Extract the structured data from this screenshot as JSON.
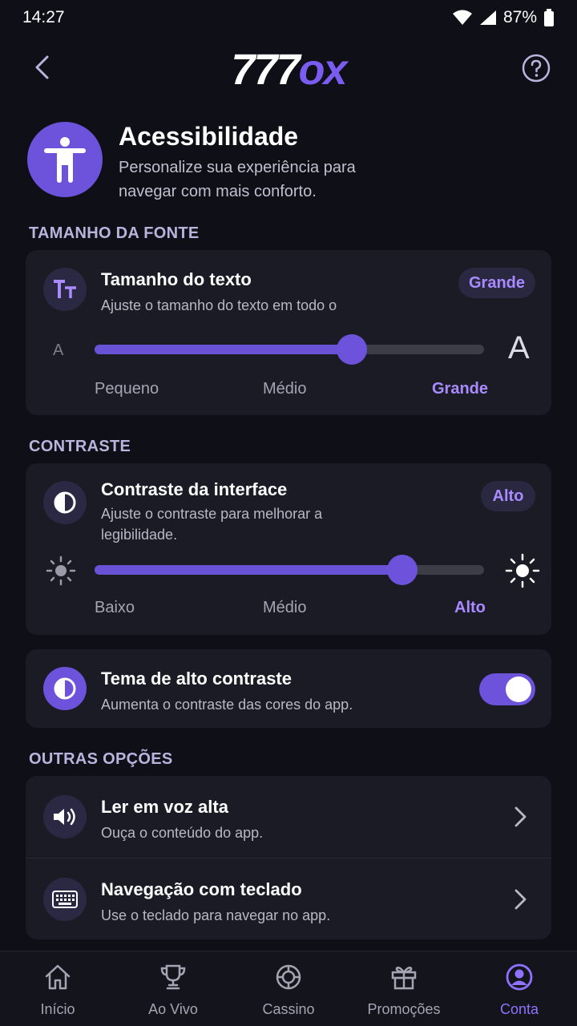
{
  "status_bar": {
    "time": "14:27",
    "battery": "87%"
  },
  "header": {
    "logo_numbers": "777",
    "logo_letters": "ox",
    "back_icon": "chevron-left-icon",
    "help_icon": "question-circle-icon"
  },
  "hero": {
    "icon": "accessibility-person-icon",
    "title": "Acessibilidade",
    "subtitle": "Personalize sua experiência para navegar com mais conforto."
  },
  "font_section": {
    "label": "TAMANHO DA FONTE",
    "title": "Tamanho do texto",
    "subtitle": "Ajuste o tamanho do texto em todo o",
    "value_badge": "Grande",
    "small_a": "A",
    "large_a": "A",
    "ticks": [
      "Pequeno",
      "Médio",
      "Grande"
    ],
    "selected_index": 2,
    "slider_value": 0.66
  },
  "contrast_section": {
    "label": "CONTRASTE",
    "title": "Contraste da interface",
    "subtitle": "Ajuste o contraste para melhorar a legibilidade.",
    "value_badge": "Alto",
    "ticks": [
      "Baixo",
      "Médio",
      "Alto"
    ],
    "selected_index": 2,
    "slider_value": 0.79
  },
  "high_contrast": {
    "title": "Tema de alto contraste",
    "subtitle": "Aumenta o contraste das cores do app.",
    "enabled": true
  },
  "other_section": {
    "label": "OUTRAS OPÇÕES",
    "items": [
      {
        "title": "Ler em voz alta",
        "subtitle": "Ouça o conteúdo do app.",
        "icon": "speaker-icon"
      },
      {
        "title": "Navegação com teclado",
        "subtitle": "Use o teclado para navegar no app.",
        "icon": "keyboard-icon"
      }
    ]
  },
  "tabs": [
    {
      "label": "Início",
      "icon": "home-icon"
    },
    {
      "label": "Ao Vivo",
      "icon": "trophy-icon"
    },
    {
      "label": "Cassino",
      "icon": "casino-chip-icon"
    },
    {
      "label": "Promoções",
      "icon": "gift-icon"
    },
    {
      "label": "Conta",
      "icon": "account-icon",
      "active": true
    }
  ],
  "colors": {
    "accent": "#6d52db",
    "accent_text": "#a98bff",
    "background": "#0f0f17",
    "card": "#1b1b25"
  }
}
